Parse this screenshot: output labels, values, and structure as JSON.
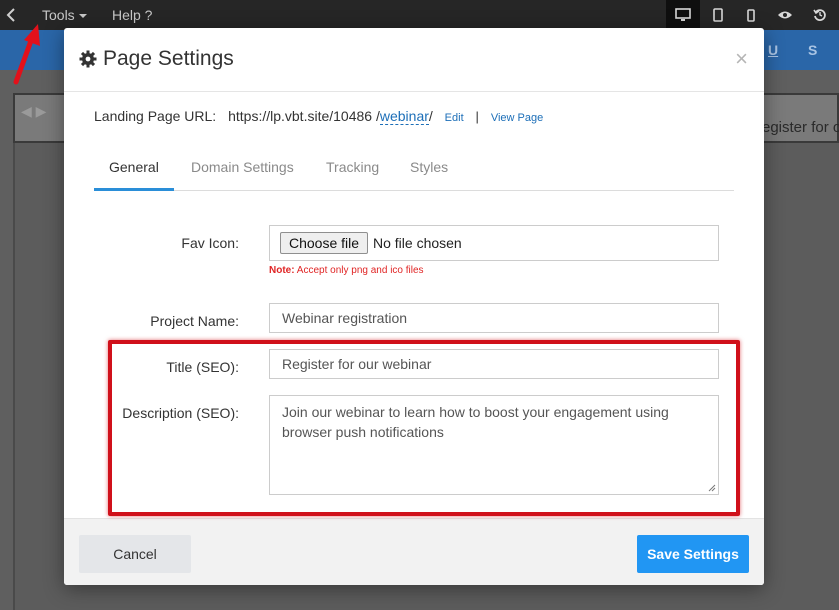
{
  "topbar": {
    "tools_label": "Tools",
    "help_label": "Help ?"
  },
  "editor": {
    "format_buttons": [
      "U",
      "S"
    ],
    "background_text": "egister for o"
  },
  "modal": {
    "title": "Page Settings",
    "close_symbol": "×",
    "url": {
      "label": "Landing Page URL:",
      "base": "https://lp.vbt.site/10486 /",
      "slug": "webinar",
      "trailing": "/",
      "edit_label": "Edit",
      "separator": "|",
      "view_label": "View Page"
    },
    "tabs": [
      "General",
      "Domain Settings",
      "Tracking",
      "Styles"
    ],
    "active_tab": "General",
    "fields": {
      "fav_icon_label": "Fav Icon:",
      "file_button": "Choose file",
      "file_status": "No file chosen",
      "fav_note": "Note: Accept only png and ico files",
      "project_name_label": "Project Name:",
      "project_name_value": "Webinar registration",
      "title_label": "Title (SEO):",
      "title_value": "Register for our webinar",
      "description_label": "Description (SEO):",
      "description_value": "Join our webinar to learn how to boost your engagement using browser push notifications"
    },
    "footer": {
      "cancel_label": "Cancel",
      "save_label": "Save Settings"
    }
  },
  "colors": {
    "accent": "#2196f3",
    "highlight": "#d0101a",
    "toolbar": "#262626",
    "editor_bar": "#2a66a8",
    "note": "#e02525"
  },
  "icons": [
    "back-chevron-icon",
    "desktop-icon",
    "tablet-icon",
    "mobile-icon",
    "eye-icon",
    "history-icon",
    "gear-icon",
    "close-icon",
    "resize-handle-icon"
  ]
}
